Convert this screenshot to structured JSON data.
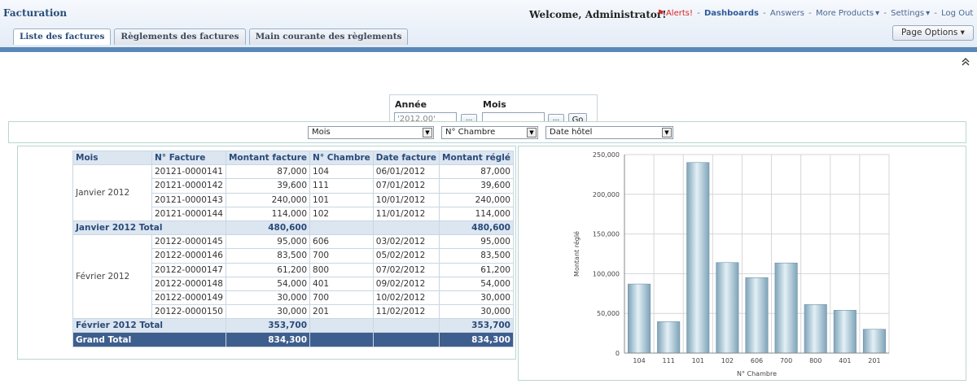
{
  "header": {
    "app_title": "Facturation",
    "welcome": "Welcome, Administrator!",
    "links": {
      "alerts": "Alerts!",
      "dashboards": "Dashboards",
      "answers": "Answers",
      "more_products": "More Products",
      "settings": "Settings",
      "logout": "Log Out"
    },
    "tabs": [
      "Liste des factures",
      "Règlements des factures",
      "Main courante des règlements"
    ],
    "page_options": "Page Options"
  },
  "prompt": {
    "annee_label": "Année",
    "annee_value": "'2012.00'",
    "mois_label": "Mois",
    "mois_value": "",
    "button_dots": "...",
    "go": "Go"
  },
  "selectors": [
    "Mois",
    "N° Chambre",
    "Date hôtel"
  ],
  "table": {
    "columns": [
      "Mois",
      "N° Facture",
      "Montant facture",
      "N° Chambre",
      "Date facture",
      "Montant réglé"
    ],
    "groups": [
      {
        "month": "Janvier 2012",
        "rows": [
          [
            "20121-0000141",
            "87,000",
            "104",
            "06/01/2012",
            "87,000"
          ],
          [
            "20121-0000142",
            "39,600",
            "111",
            "07/01/2012",
            "39,600"
          ],
          [
            "20121-0000143",
            "240,000",
            "101",
            "10/01/2012",
            "240,000"
          ],
          [
            "20121-0000144",
            "114,000",
            "102",
            "11/01/2012",
            "114,000"
          ]
        ],
        "total_label": "Janvier 2012 Total",
        "total_facture": "480,600",
        "total_regle": "480,600"
      },
      {
        "month": "Février 2012",
        "rows": [
          [
            "20122-0000145",
            "95,000",
            "606",
            "03/02/2012",
            "95,000"
          ],
          [
            "20122-0000146",
            "83,500",
            "700",
            "05/02/2012",
            "83,500"
          ],
          [
            "20122-0000147",
            "61,200",
            "800",
            "07/02/2012",
            "61,200"
          ],
          [
            "20122-0000148",
            "54,000",
            "401",
            "09/02/2012",
            "54,000"
          ],
          [
            "20122-0000149",
            "30,000",
            "700",
            "10/02/2012",
            "30,000"
          ],
          [
            "20122-0000150",
            "30,000",
            "201",
            "11/02/2012",
            "30,000"
          ]
        ],
        "total_label": "Février 2012 Total",
        "total_facture": "353,700",
        "total_regle": "353,700"
      }
    ],
    "grand_total_label": "Grand Total",
    "grand_total_facture": "834,300",
    "grand_total_regle": "834,300"
  },
  "chart_data": {
    "type": "bar",
    "categories": [
      "104",
      "111",
      "101",
      "102",
      "606",
      "700",
      "800",
      "401",
      "201"
    ],
    "values": [
      87000,
      39600,
      240000,
      114000,
      95000,
      113500,
      61200,
      54000,
      30000
    ],
    "y_tick_labels": [
      "0",
      "50,000",
      "100,000",
      "150,000",
      "200,000",
      "250,000"
    ],
    "xlabel": "N° Chambre",
    "ylabel": "Montant réglé",
    "ylim": [
      0,
      250000
    ],
    "grid": true,
    "colors": {
      "bar_light": "#e3f0f6",
      "bar_dark": "#7ea3b8",
      "grid": "#d6d6d6"
    }
  }
}
